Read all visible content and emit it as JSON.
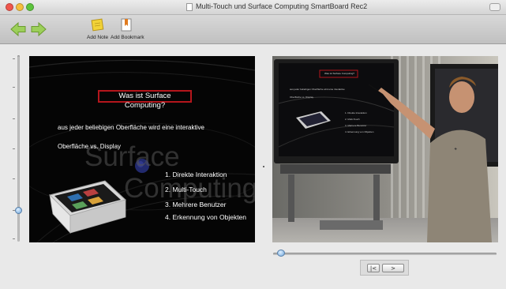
{
  "window": {
    "title": "Multi-Touch und Surface Computing SmartBoard Rec2"
  },
  "toolbar": {
    "back_icon": "back-arrow-icon",
    "forward_icon": "forward-arrow-icon",
    "add_note_label": "Add Note",
    "add_bookmark_label": "Add Bookmark"
  },
  "slide": {
    "title": "Was ist Surface Computing?",
    "line1": "aus jeder beliebigen Oberfläche wird eine interaktive",
    "line2": "Oberfläche vs. Display",
    "ghost1": "Surface",
    "ghost2": "Computing",
    "bullets": [
      "1. Direkte Interaktion",
      "2. Multi-Touch",
      "3. Mehrere Benutzer",
      "4. Erkennung von Objekten"
    ]
  },
  "video": {
    "board_title": "Was ist Surface Computing?",
    "board_line1": "aus jeder beliebigen Oberfläche wird eine interaktive",
    "board_line2": "Oberfläche vs. Display",
    "board_bullets": [
      "1. Direkte Interaktion",
      "2. Multi-Touch",
      "3. Mehrere Benutzer",
      "4. Erkennung von Objekten"
    ]
  },
  "playback": {
    "position": 0.02,
    "prev_label": "|<",
    "next_label": ">"
  },
  "colors": {
    "accent_red": "#b5161c",
    "slider_blue": "#6fa6dc",
    "arrow_green": "#8cc63f"
  }
}
